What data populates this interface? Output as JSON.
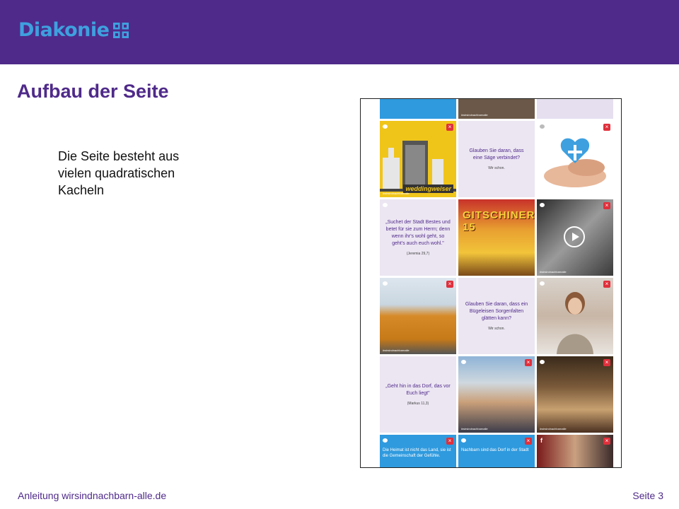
{
  "header": {
    "logo_text": "Diakonie",
    "brand_color": "#4f2a8a",
    "logo_color": "#3ea0df"
  },
  "slide": {
    "title": "Aufbau der Seite",
    "body": "Die Seite besteht aus\nvielen quadratischen\nKacheln"
  },
  "screenshot": {
    "tiles": {
      "quote_saege": "Glauben Sie daran, dass eine Säge verbindet?",
      "quote_saege_sub": "Wir schon.",
      "quote_jeremia": "„Suchet der Stadt Bestes und betet für sie zum Herrn; denn wenn ihr's wohl geht, so geht's auch euch wohl.\"",
      "quote_jeremia_ref": "(Jeremia 29,7)",
      "quote_buegel": "Glauben Sie daran, dass ein Bügeleisen Sorgenfalten glätten kann?",
      "quote_buegel_sub": "Wir schon.",
      "quote_dorf": "„Geht hin in das Dorf, das vor Euch liegt\"",
      "quote_dorf_ref": "(Markus 11,3)",
      "blue_heimat": "Die Heimat ist nicht das Land, sie ist die Gemeinschaft der Gefühle.",
      "blue_nachbarn": "Nachbarn sind das Dorf in der Stadt",
      "weddingweiser": "weddingweiser",
      "gitschiner": "GITSCHINER 15",
      "tag": "#wirsindnachbarnalle"
    }
  },
  "footer": {
    "left": "Anleitung wirsindnachbarn-alle.de",
    "right": "Seite  3"
  }
}
